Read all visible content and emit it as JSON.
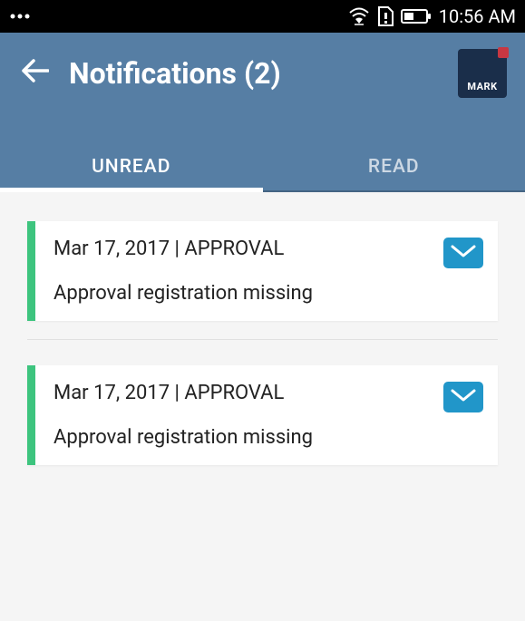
{
  "statusBar": {
    "time": "10:56 AM"
  },
  "header": {
    "title": "Notifications (2)",
    "logoText": "MARK"
  },
  "tabs": {
    "unread": "UNREAD",
    "read": "READ",
    "active": "unread"
  },
  "notifications": [
    {
      "date": "Mar 17, 2017",
      "category": "APPROVAL",
      "separator": " | ",
      "message": "Approval registration missing",
      "stripeColor": "#3dc47e",
      "unread": true
    },
    {
      "date": "Mar 17, 2017",
      "category": "APPROVAL",
      "separator": " | ",
      "message": "Approval registration missing",
      "stripeColor": "#3dc47e",
      "unread": true
    }
  ]
}
